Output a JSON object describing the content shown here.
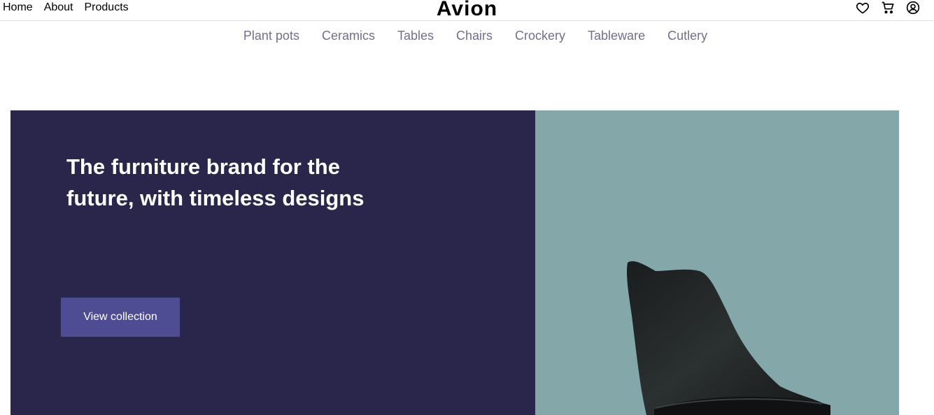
{
  "topbar": {
    "nav": [
      "Home",
      "About",
      "Products"
    ],
    "brand": "Avion",
    "icons": [
      "heart-icon",
      "cart-icon",
      "user-icon"
    ]
  },
  "categories": [
    "Plant pots",
    "Ceramics",
    "Tables",
    "Chairs",
    "Crockery",
    "Tableware",
    "Cutlery"
  ],
  "hero": {
    "title": "The furniture brand for the future, with timeless designs",
    "button_label": "View collection",
    "colors": {
      "left_bg": "#2a254b",
      "button_bg": "#4e4d93",
      "right_bg": "#84a8aa",
      "category_text": "#726e8d"
    }
  }
}
